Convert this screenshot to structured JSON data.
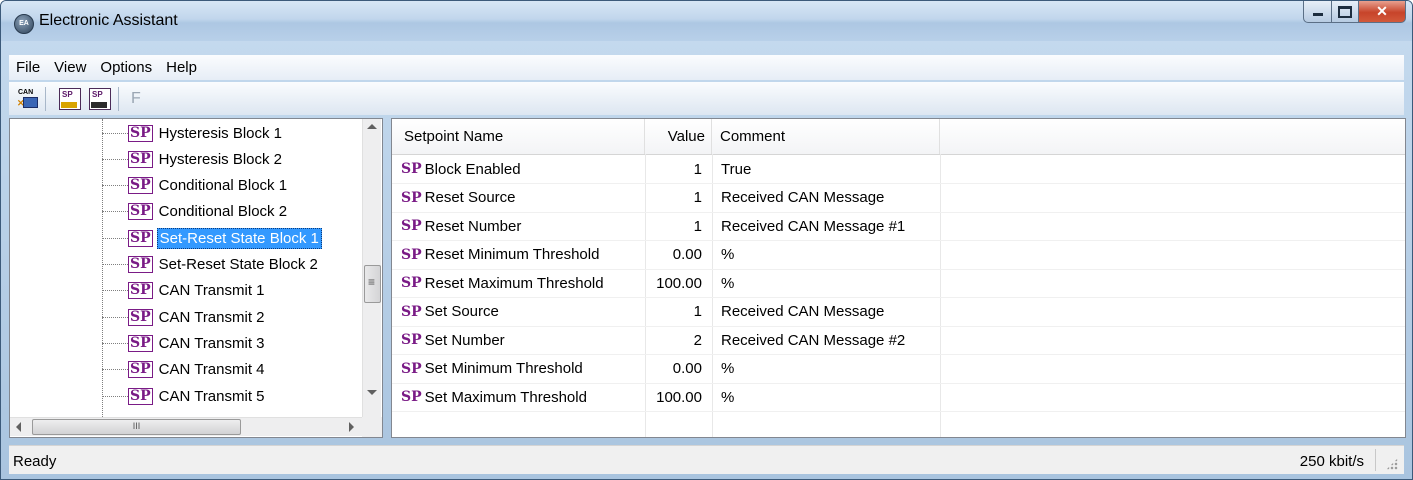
{
  "window": {
    "title": "Electronic Assistant",
    "icon_text": "EA",
    "icon": "app-globe-icon"
  },
  "menu": [
    "File",
    "View",
    "Options",
    "Help"
  ],
  "toolbar": {
    "can_icon_text": "CAN",
    "sp_icon_text": "SP",
    "f_label": "F"
  },
  "tree": {
    "badge": "SP",
    "selected_index": 4,
    "items": [
      "Hysteresis Block 1",
      "Hysteresis Block 2",
      "Conditional Block 1",
      "Conditional Block 2",
      "Set-Reset State Block 1",
      "Set-Reset State Block 2",
      "CAN Transmit 1",
      "CAN Transmit 2",
      "CAN Transmit 3",
      "CAN Transmit 4",
      "CAN Transmit 5"
    ],
    "hscroll_grip": "III"
  },
  "grid": {
    "columns": [
      "Setpoint Name",
      "Value",
      "Comment"
    ],
    "sp_prefix": "SP",
    "rows": [
      {
        "name": "Block Enabled",
        "value": "1",
        "comment": "True"
      },
      {
        "name": "Reset Source",
        "value": "1",
        "comment": "Received CAN Message"
      },
      {
        "name": "Reset Number",
        "value": "1",
        "comment": "Received CAN Message #1"
      },
      {
        "name": "Reset Minimum Threshold",
        "value": "0.00",
        "comment": "%"
      },
      {
        "name": "Reset Maximum Threshold",
        "value": "100.00",
        "comment": "%"
      },
      {
        "name": "Set Source",
        "value": "1",
        "comment": "Received CAN Message"
      },
      {
        "name": "Set Number",
        "value": "2",
        "comment": "Received CAN Message #2"
      },
      {
        "name": "Set Minimum Threshold",
        "value": "0.00",
        "comment": "%"
      },
      {
        "name": "Set Maximum Threshold",
        "value": "100.00",
        "comment": "%"
      }
    ]
  },
  "status": {
    "left": "Ready",
    "right": "250 kbit/s"
  },
  "colors": {
    "sp_badge": "#7a1b86",
    "selection": "#3399ff",
    "close_button": "#c7442a"
  }
}
